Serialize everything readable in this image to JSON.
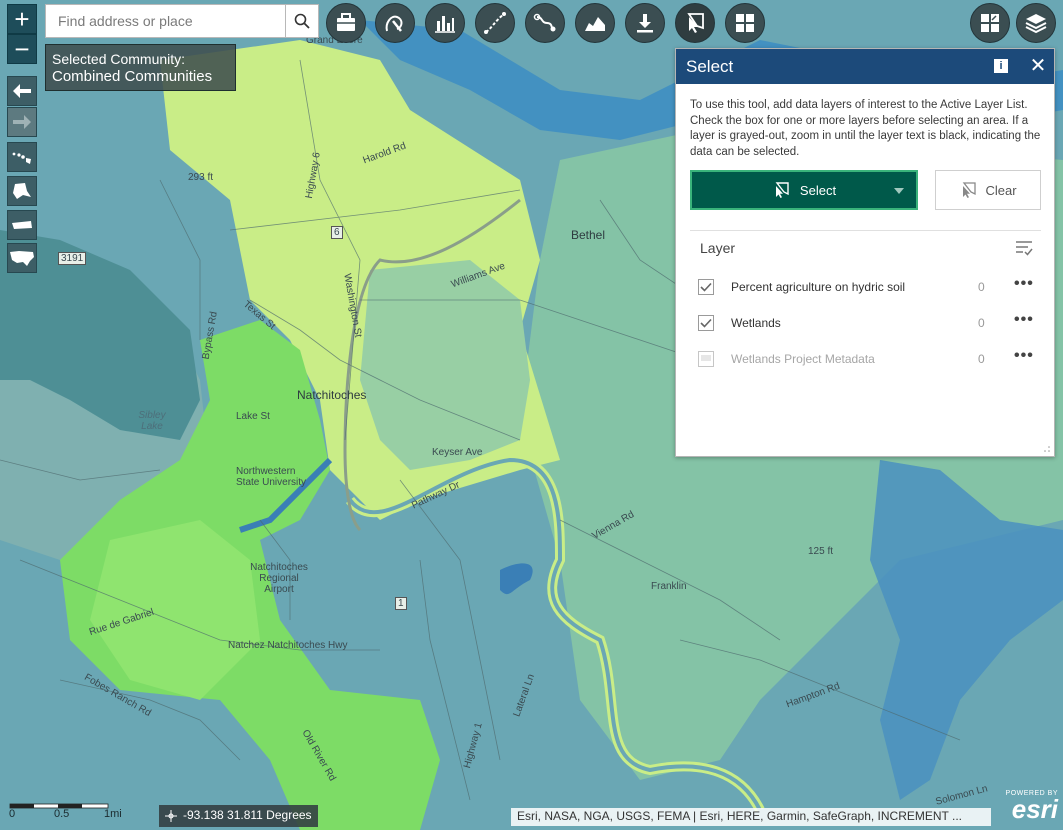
{
  "search": {
    "placeholder": "Find address or place"
  },
  "community": {
    "label": "Selected Community:",
    "value": "Combined Communities"
  },
  "zoom": {
    "in": "+",
    "out": "−"
  },
  "toolbar": {
    "tools": [
      "briefcase-icon",
      "drawing-icon",
      "chart-icon",
      "measure-icon",
      "directions-icon",
      "profile-icon",
      "download-icon",
      "select-tool-icon",
      "widget-grid-icon"
    ],
    "right": [
      "basemap-gallery-icon",
      "layers-icon"
    ]
  },
  "panel": {
    "title": "Select",
    "info_label": "i",
    "close_label": "✕",
    "description": "To use this tool, add data layers of interest to the Active Layer List. Check the box for one or more layers before selecting an area. If a layer is grayed-out, zoom in until the layer text is black, indicating the data can be selected.",
    "select_label": "Select",
    "clear_label": "Clear",
    "layer_header": "Layer",
    "layers": [
      {
        "name": "Percent agriculture on hydric soil",
        "count": "0",
        "checked": true,
        "enabled": true
      },
      {
        "name": "Wetlands",
        "count": "0",
        "checked": true,
        "enabled": true
      },
      {
        "name": "Wetlands Project Metadata",
        "count": "0",
        "checked": false,
        "enabled": false
      }
    ],
    "more_label": "•••"
  },
  "map": {
    "labels": {
      "natchitoches": "Natchitoches",
      "bethel": "Bethel",
      "grand_ecore": "Grand Ecore",
      "sibley_lake": "Sibley Lake",
      "lake_st": "Lake St",
      "nsu": "Northwestern State University",
      "airport": "Natchitoches Regional Airport",
      "rue_de_gabriel": "Rue de Gabriel",
      "natchez_hwy": "Natchez Natchitoches Hwy",
      "keyser_ave": "Keyser Ave",
      "williams_ave": "Williams Ave",
      "texas_st": "Texas St",
      "washington_st": "Washington St",
      "vienna_rd": "Vienna Rd",
      "franklin": "Franklin",
      "lateral_ln": "Lateral Ln",
      "highway_1": "Highway 1",
      "hampton_rd": "Hampton Rd",
      "harold_rd": "Harold Rd",
      "fobes_ranch_rd": "Fobes Ranch Rd",
      "solomon_ln": "Solomon Ln",
      "old_river_rd": "Old River Rd",
      "bypass_rd": "Bypass Rd",
      "pathway_dr": "Pathway Dr",
      "highway_6": "Highway 6",
      "elev_293": "293 ft",
      "elev_125": "125 ft",
      "route_3191": "3191",
      "route_6": "6",
      "route_1": "1"
    }
  },
  "scale": {
    "zero": "0",
    "half": "0.5",
    "one": "1mi"
  },
  "coords": {
    "text": "-93.138 31.811 Degrees"
  },
  "attribution": {
    "text": "Esri, NASA, NGA, USGS, FEMA | Esri, HERE, Garmin, SafeGraph, INCREMENT ..."
  },
  "esri": {
    "powered": "POWERED BY",
    "name": "esri"
  },
  "colors": {
    "panel_header": "#1c4a7a",
    "select_button": "#00594a",
    "select_border": "#3ab37b",
    "map_blue": "#6aa7b4",
    "map_teal": "#84c3a6",
    "map_lime": "#c9ed87",
    "map_green": "#7ddc66",
    "river": "#3f8fc2"
  }
}
